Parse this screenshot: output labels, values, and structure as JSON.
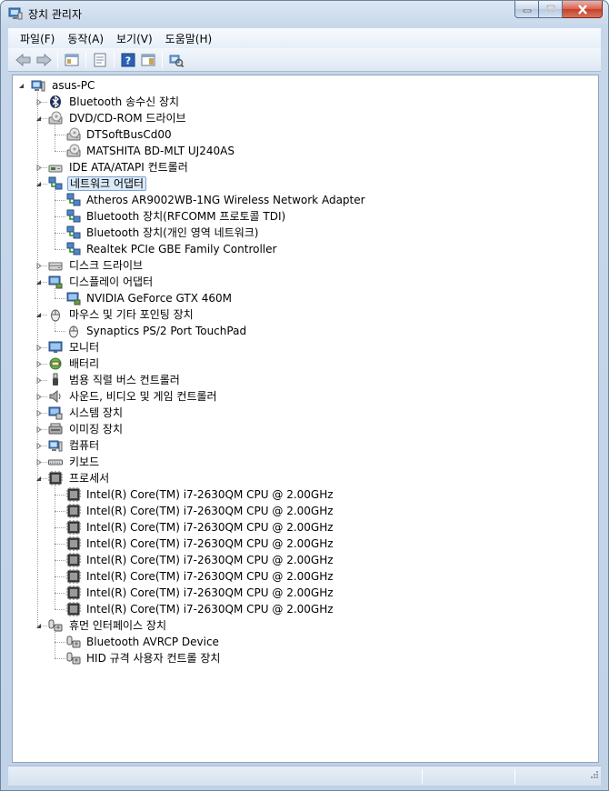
{
  "window": {
    "title": "장치 관리자"
  },
  "menu": [
    {
      "label": "파일(F)"
    },
    {
      "label": "동작(A)"
    },
    {
      "label": "보기(V)"
    },
    {
      "label": "도움말(H)"
    }
  ],
  "toolbar": [
    {
      "icon": "back-arrow-icon"
    },
    {
      "icon": "forward-arrow-icon"
    },
    {
      "sep": true
    },
    {
      "icon": "console-tree-icon"
    },
    {
      "sep": true
    },
    {
      "icon": "properties-icon"
    },
    {
      "sep": true
    },
    {
      "icon": "help-icon"
    },
    {
      "icon": "action-pane-icon"
    },
    {
      "sep": true
    },
    {
      "icon": "scan-hardware-icon"
    }
  ],
  "tree": [
    {
      "level": 0,
      "label": "asus-PC",
      "icon": "computer",
      "exp": "open"
    },
    {
      "level": 1,
      "label": "Bluetooth 송수신 장치",
      "icon": "bluetooth",
      "exp": "closed"
    },
    {
      "level": 1,
      "label": "DVD/CD-ROM 드라이브",
      "icon": "disc",
      "exp": "open"
    },
    {
      "level": 2,
      "label": "DTSoftBusCd00",
      "icon": "disc"
    },
    {
      "level": 2,
      "label": "MATSHITA BD-MLT UJ240AS",
      "icon": "disc"
    },
    {
      "level": 1,
      "label": "IDE ATA/ATAPI 컨트롤러",
      "icon": "controller",
      "exp": "closed"
    },
    {
      "level": 1,
      "label": "네트워크 어댑터",
      "icon": "network",
      "exp": "open",
      "selected": true
    },
    {
      "level": 2,
      "label": "Atheros AR9002WB-1NG Wireless Network Adapter",
      "icon": "network"
    },
    {
      "level": 2,
      "label": "Bluetooth 장치(RFCOMM 프로토콜 TDI)",
      "icon": "network"
    },
    {
      "level": 2,
      "label": "Bluetooth 장치(개인 영역 네트워크)",
      "icon": "network"
    },
    {
      "level": 2,
      "label": "Realtek PCIe GBE Family Controller",
      "icon": "network"
    },
    {
      "level": 1,
      "label": "디스크 드라이브",
      "icon": "disk",
      "exp": "closed"
    },
    {
      "level": 1,
      "label": "디스플레이 어댑터",
      "icon": "display",
      "exp": "open"
    },
    {
      "level": 2,
      "label": "NVIDIA GeForce GTX 460M",
      "icon": "display"
    },
    {
      "level": 1,
      "label": "마우스 및 기타 포인팅 장치",
      "icon": "mouse",
      "exp": "open"
    },
    {
      "level": 2,
      "label": "Synaptics PS/2 Port TouchPad",
      "icon": "mouse"
    },
    {
      "level": 1,
      "label": "모니터",
      "icon": "monitor",
      "exp": "closed"
    },
    {
      "level": 1,
      "label": "배터리",
      "icon": "battery",
      "exp": "closed"
    },
    {
      "level": 1,
      "label": "범용 직렬 버스 컨트롤러",
      "icon": "usb",
      "exp": "closed"
    },
    {
      "level": 1,
      "label": "사운드, 비디오 및 게임 컨트롤러",
      "icon": "sound",
      "exp": "closed"
    },
    {
      "level": 1,
      "label": "시스템 장치",
      "icon": "system",
      "exp": "closed"
    },
    {
      "level": 1,
      "label": "이미징 장치",
      "icon": "imaging",
      "exp": "closed"
    },
    {
      "level": 1,
      "label": "컴퓨터",
      "icon": "computer",
      "exp": "closed"
    },
    {
      "level": 1,
      "label": "키보드",
      "icon": "keyboard",
      "exp": "closed"
    },
    {
      "level": 1,
      "label": "프로세서",
      "icon": "processor",
      "exp": "open"
    },
    {
      "level": 2,
      "label": "Intel(R) Core(TM) i7-2630QM CPU @ 2.00GHz",
      "icon": "processor"
    },
    {
      "level": 2,
      "label": "Intel(R) Core(TM) i7-2630QM CPU @ 2.00GHz",
      "icon": "processor"
    },
    {
      "level": 2,
      "label": "Intel(R) Core(TM) i7-2630QM CPU @ 2.00GHz",
      "icon": "processor"
    },
    {
      "level": 2,
      "label": "Intel(R) Core(TM) i7-2630QM CPU @ 2.00GHz",
      "icon": "processor"
    },
    {
      "level": 2,
      "label": "Intel(R) Core(TM) i7-2630QM CPU @ 2.00GHz",
      "icon": "processor"
    },
    {
      "level": 2,
      "label": "Intel(R) Core(TM) i7-2630QM CPU @ 2.00GHz",
      "icon": "processor"
    },
    {
      "level": 2,
      "label": "Intel(R) Core(TM) i7-2630QM CPU @ 2.00GHz",
      "icon": "processor"
    },
    {
      "level": 2,
      "label": "Intel(R) Core(TM) i7-2630QM CPU @ 2.00GHz",
      "icon": "processor"
    },
    {
      "level": 1,
      "label": "휴먼 인터페이스 장치",
      "icon": "hid",
      "exp": "open"
    },
    {
      "level": 2,
      "label": "Bluetooth AVRCP Device",
      "icon": "hid"
    },
    {
      "level": 2,
      "label": "HID 규격 사용자 컨트롤 장치",
      "icon": "hid"
    }
  ]
}
